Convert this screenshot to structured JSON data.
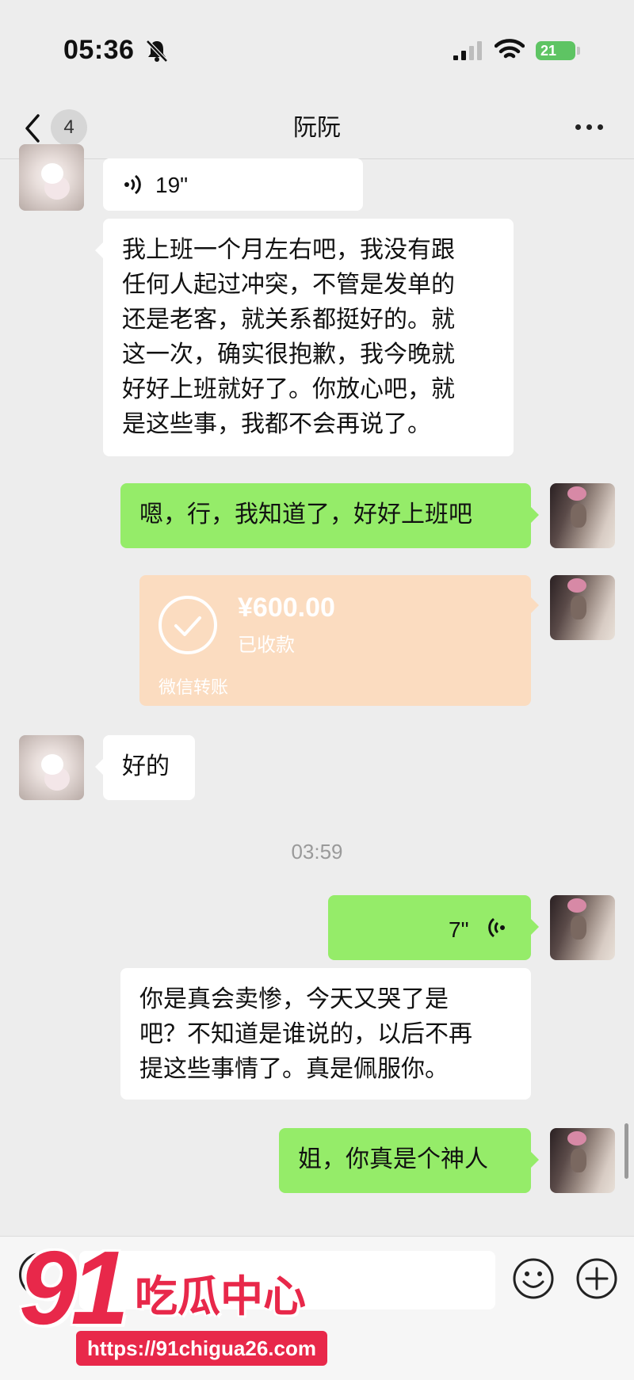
{
  "status_bar": {
    "time": "05:36",
    "battery": "21",
    "icons": [
      "bell-muted-icon",
      "signal-icon",
      "wifi-icon",
      "battery-charging-icon"
    ]
  },
  "header": {
    "unread_count": "4",
    "title": "阮阮",
    "icons": [
      "chevron-left-icon",
      "more-icon"
    ]
  },
  "messages": [
    {
      "sender": "other",
      "type": "voice",
      "duration": "19\""
    },
    {
      "sender": "other",
      "type": "text",
      "lines": [
        "我上班一个月左右吧，我没有跟",
        "任何人起过冲突，不管是发单的",
        "还是老客，就关系都挺好的。就",
        "这一次，确实很抱歉，我今晚就",
        "好好上班就好了。你放心吧，就",
        "是这些事，我都不会再说了。"
      ]
    },
    {
      "sender": "self",
      "type": "text",
      "text": "嗯，行，我知道了，好好上班吧"
    },
    {
      "sender": "self",
      "type": "transfer",
      "amount": "¥600.00",
      "status": "已收款",
      "footer": "微信转账"
    },
    {
      "sender": "other",
      "type": "text",
      "text": "好的"
    },
    {
      "type": "timestamp",
      "text": "03:59"
    },
    {
      "sender": "self",
      "type": "voice",
      "duration": "7\""
    },
    {
      "sender": "self",
      "type": "voice-to-text",
      "lines": [
        "你是真会卖惨，今天又哭了是",
        "吧？不知道是谁说的，以后不再",
        "提这些事情了。真是佩服你。"
      ]
    },
    {
      "sender": "self",
      "type": "text",
      "text": "姐，你真是个神人"
    }
  ],
  "input_bar": {
    "placeholder": "",
    "icons": [
      "voice-icon",
      "emoji-icon",
      "plus-icon"
    ]
  },
  "watermark": {
    "number": "91",
    "name": "吃瓜中心",
    "url": "https://91chigua26.com"
  },
  "colors": {
    "background": "#ededed",
    "self_bubble": "#95ec69",
    "other_bubble": "#ffffff",
    "transfer_card": "#fbdcc0",
    "watermark_red": "#e8284a"
  }
}
